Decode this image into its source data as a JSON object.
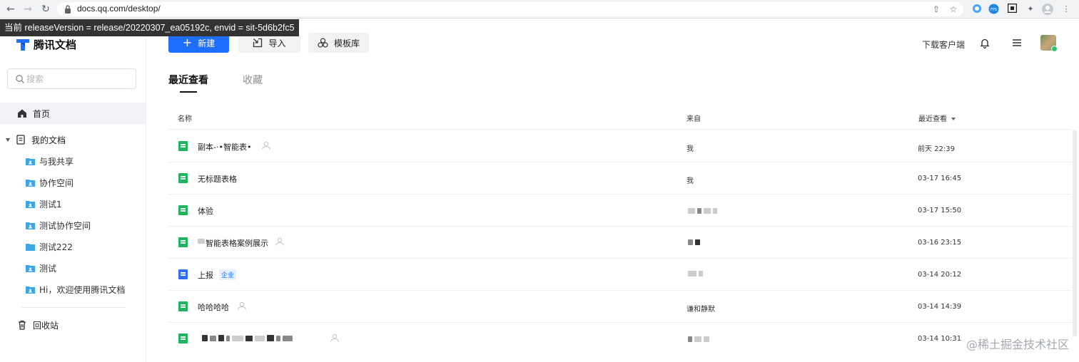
{
  "browser": {
    "url": "docs.qq.com/desktop/",
    "ext_fps": "FPS"
  },
  "overlay": "当前 releaseVersion = release/20220307_ea05192c, envid = sit-5d6b2fc5",
  "sidebar": {
    "logo_text": "腾讯文档",
    "search_placeholder": "搜索",
    "home": "首页",
    "my_docs": "我的文档",
    "folders": [
      {
        "label": "与我共享",
        "shared": true
      },
      {
        "label": "协作空间",
        "shared": true
      },
      {
        "label": "测试1",
        "shared": true
      },
      {
        "label": "测试协作空间",
        "shared": true
      },
      {
        "label": "测试222",
        "shared": false
      },
      {
        "label": "测试",
        "shared": true
      },
      {
        "label": "Hi，欢迎使用腾讯文档",
        "shared": true
      }
    ],
    "trash": "回收站"
  },
  "toolbar": {
    "new_label": "新建",
    "import_label": "导入",
    "template_label": "模板库",
    "download_client": "下载客户端"
  },
  "tabs": {
    "recent": "最近查看",
    "favorites": "收藏"
  },
  "table": {
    "col_name": "名称",
    "col_from": "来自",
    "col_recent": "最近查看",
    "rows": [
      {
        "name": "副本-·•智能表•",
        "type": "sheet",
        "shared": true,
        "from": "我",
        "time": "前天 22:39"
      },
      {
        "name": "无标题表格",
        "type": "sheet",
        "shared": false,
        "from": "我",
        "time": "03-17 16:45"
      },
      {
        "name": "体验",
        "type": "sheet",
        "shared": false,
        "from": "",
        "time": "03-17 15:50"
      },
      {
        "name": "智能表格案例展示",
        "type": "sheet",
        "shared": true,
        "from": "",
        "time": "03-16 23:15"
      },
      {
        "name": "上报",
        "type": "doc",
        "shared": false,
        "badge": "企业",
        "from": "",
        "time": "03-14 20:12"
      },
      {
        "name": "哈哈哈哈",
        "type": "sheet",
        "shared": true,
        "from": "谦和静默",
        "time": "03-14 14:39"
      },
      {
        "name": "",
        "type": "sheet",
        "shared": true,
        "from": "",
        "time": "03-14 10:31"
      }
    ]
  },
  "watermark": "@稀土掘金技术社区"
}
